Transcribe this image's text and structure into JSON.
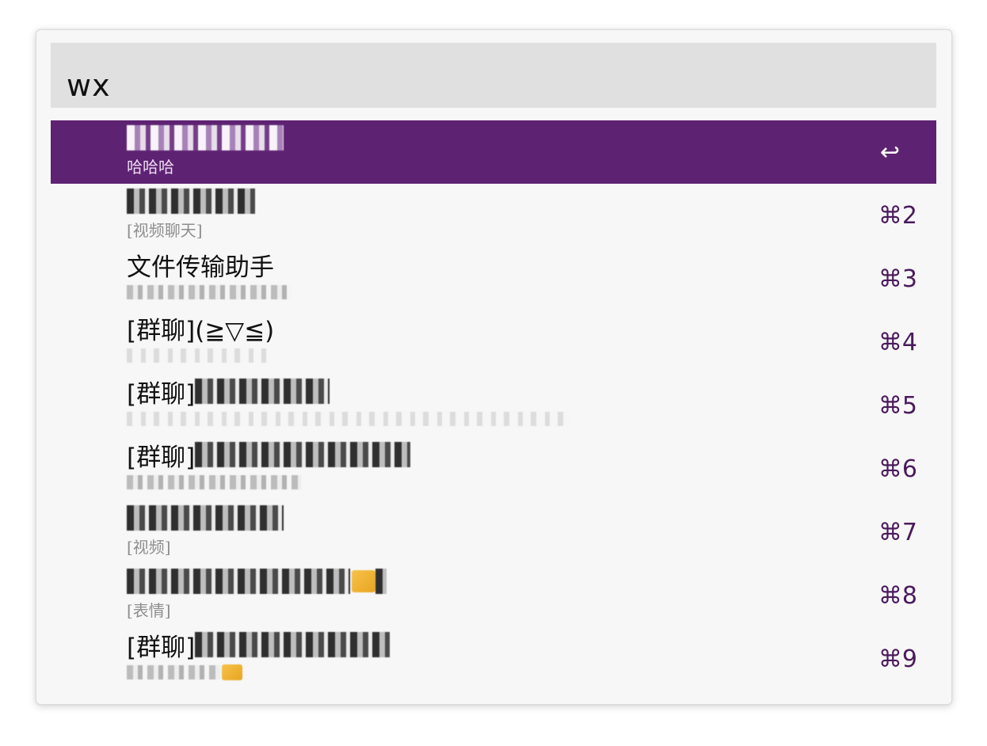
{
  "search": {
    "query": "wx"
  },
  "results": [
    {
      "title": "",
      "subtitle": "哈哈哈",
      "shortcut": "↩",
      "selected": true
    },
    {
      "title": "",
      "subtitle": "[视频聊天]",
      "shortcut": "⌘2"
    },
    {
      "title": "文件传输助手",
      "subtitle": "",
      "shortcut": "⌘3"
    },
    {
      "title": "[群聊](≧▽≦)",
      "subtitle": "",
      "shortcut": "⌘4"
    },
    {
      "title": "[群聊]",
      "subtitle": "",
      "shortcut": "⌘5"
    },
    {
      "title": "[群聊]",
      "subtitle": "",
      "shortcut": "⌘6"
    },
    {
      "title": "",
      "subtitle": "[视频]",
      "shortcut": "⌘7"
    },
    {
      "title": "",
      "subtitle": "[表情]",
      "shortcut": "⌘8"
    },
    {
      "title": "[群聊]",
      "subtitle": "",
      "shortcut": "⌘9"
    }
  ],
  "colors": {
    "selected_row": "#5e2272",
    "shortcut": "#4b1a5c",
    "search_bar": "#e0e0e0",
    "panel": "#f7f7f7"
  }
}
